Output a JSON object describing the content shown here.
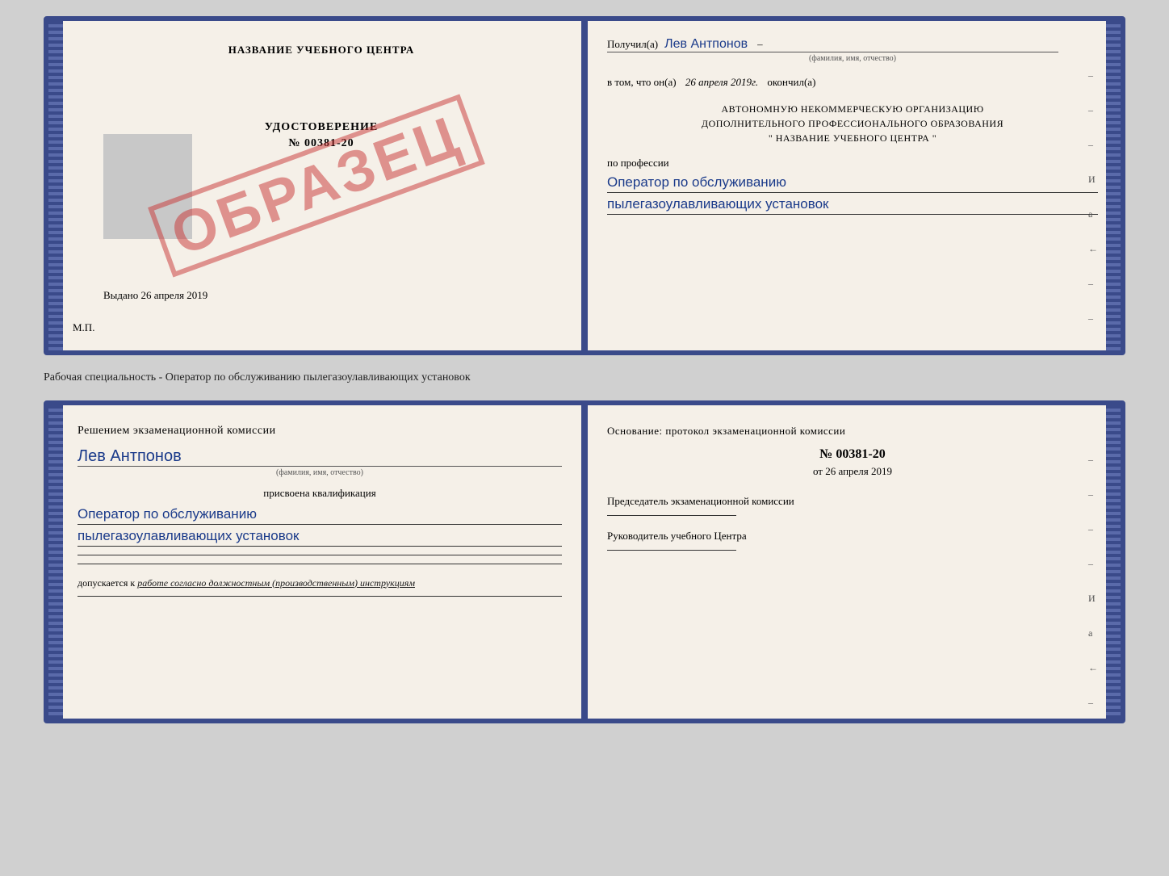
{
  "page": {
    "background": "#d0d0d0"
  },
  "top_cert": {
    "left": {
      "title": "НАЗВАНИЕ УЧЕБНОГО ЦЕНТРА",
      "stamp_text": "ОБРАЗЕЦ",
      "cert_type": "УДОСТОВЕРЕНИЕ",
      "cert_number": "№ 00381-20",
      "issued_label": "Выдано",
      "issued_date": "26 апреля 2019",
      "mp_label": "М.П."
    },
    "right": {
      "received_label": "Получил(а)",
      "recipient_name": "Лев Антпонов",
      "fio_label": "(фамилия, имя, отчество)",
      "date_prefix": "в том, что он(а)",
      "date_value": "26 апреля 2019г.",
      "completed_label": "окончил(а)",
      "org_line1": "АВТОНОМНУЮ НЕКОММЕРЧЕСКУЮ ОРГАНИЗАЦИЮ",
      "org_line2": "ДОПОЛНИТЕЛЬНОГО ПРОФЕССИОНАЛЬНОГО ОБРАЗОВАНИЯ",
      "org_line3": "\"   НАЗВАНИЕ УЧЕБНОГО ЦЕНТРА   \"",
      "profession_label": "по профессии",
      "profession_line1": "Оператор по обслуживанию",
      "profession_line2": "пылегазоулавливающих установок",
      "right_dashes": [
        "–",
        "–",
        "–",
        "И",
        "а",
        "←",
        "–",
        "–",
        "–",
        "–"
      ]
    }
  },
  "subtitle": "Рабочая специальность - Оператор по обслуживанию пылегазоулавливающих установок",
  "bottom_cert": {
    "left": {
      "decision_text": "Решением экзаменационной комиссии",
      "person_name": "Лев Антпонов",
      "fio_label": "(фамилия, имя, отчество)",
      "qualification_label": "присвоена квалификация",
      "profession_line1": "Оператор по обслуживанию",
      "profession_line2": "пылегазоулавливающих установок",
      "blank_lines": 2,
      "allow_label": "допускается к",
      "allow_value": "работе согласно должностным (производственным) инструкциям"
    },
    "right": {
      "basis_label": "Основание: протокол экзаменационной комиссии",
      "protocol_number": "№  00381-20",
      "protocol_date_prefix": "от",
      "protocol_date": "26 апреля 2019",
      "chairman_label": "Председатель экзаменационной комиссии",
      "head_label": "Руководитель учебного Центра",
      "right_dashes": [
        "–",
        "–",
        "–",
        "–",
        "И",
        "а",
        "←",
        "–",
        "–",
        "–",
        "–"
      ]
    }
  }
}
